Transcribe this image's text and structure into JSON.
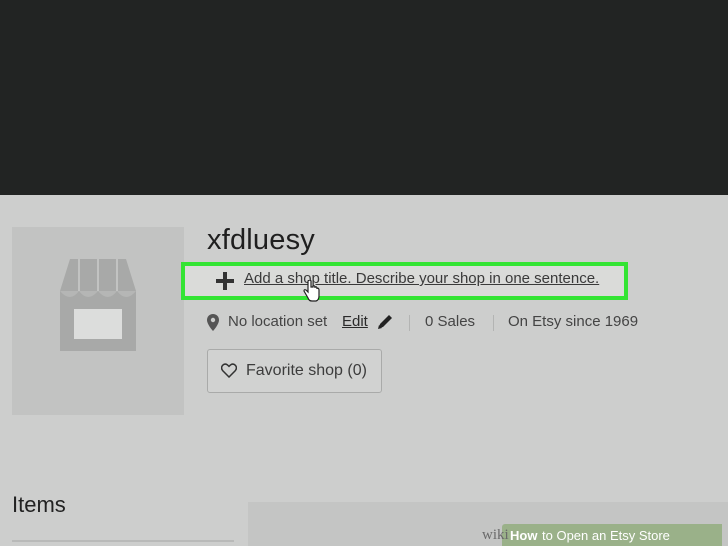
{
  "shop": {
    "name": "xfdluesy",
    "title_prompt": "Add a shop title. Describe your shop in one sentence.",
    "location": "No location set",
    "edit_label": "Edit",
    "sales": "0 Sales",
    "since": "On Etsy since 1969",
    "favorite_label": "Favorite shop (0)"
  },
  "items": {
    "heading": "Items"
  },
  "watermark": {
    "wiki": "wiki",
    "how": "How",
    "rest": "to Open an Etsy Store"
  },
  "colors": {
    "highlight": "#33e433",
    "top_band": "#222423",
    "background": "#cdcecd"
  },
  "icons": [
    "storefront-icon",
    "plus-icon",
    "hand-cursor-icon",
    "location-pin-icon",
    "pencil-icon",
    "heart-icon"
  ]
}
